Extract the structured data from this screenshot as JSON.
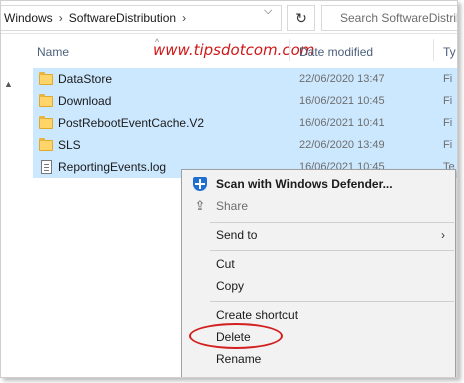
{
  "breadcrumb": [
    "Windows",
    "SoftwareDistribution"
  ],
  "search": {
    "placeholder": "Search SoftwareDistributi"
  },
  "watermark": "www.tipsdotcom.com",
  "columns": {
    "name": "Name",
    "date": "Date modified",
    "type": "Ty"
  },
  "files": [
    {
      "name": "DataStore",
      "date": "22/06/2020 13:47",
      "type": "Fi",
      "kind": "folder",
      "selected": true
    },
    {
      "name": "Download",
      "date": "16/06/2021 10:45",
      "type": "Fi",
      "kind": "folder",
      "selected": true
    },
    {
      "name": "PostRebootEventCache.V2",
      "date": "16/06/2021 10:41",
      "type": "Fi",
      "kind": "folder",
      "selected": true
    },
    {
      "name": "SLS",
      "date": "22/06/2020 13:49",
      "type": "Fi",
      "kind": "folder",
      "selected": true
    },
    {
      "name": "ReportingEvents.log",
      "date": "16/06/2021 10:45",
      "type": "Te",
      "kind": "file",
      "selected": true
    }
  ],
  "context_menu": {
    "scan": "Scan with Windows Defender...",
    "share": "Share",
    "send_to": "Send to",
    "cut": "Cut",
    "copy": "Copy",
    "create_shortcut": "Create shortcut",
    "delete": "Delete",
    "rename": "Rename"
  },
  "colors": {
    "selection": "#cce8ff",
    "highlight": "#d31f1f",
    "watermark": "#d01818"
  }
}
